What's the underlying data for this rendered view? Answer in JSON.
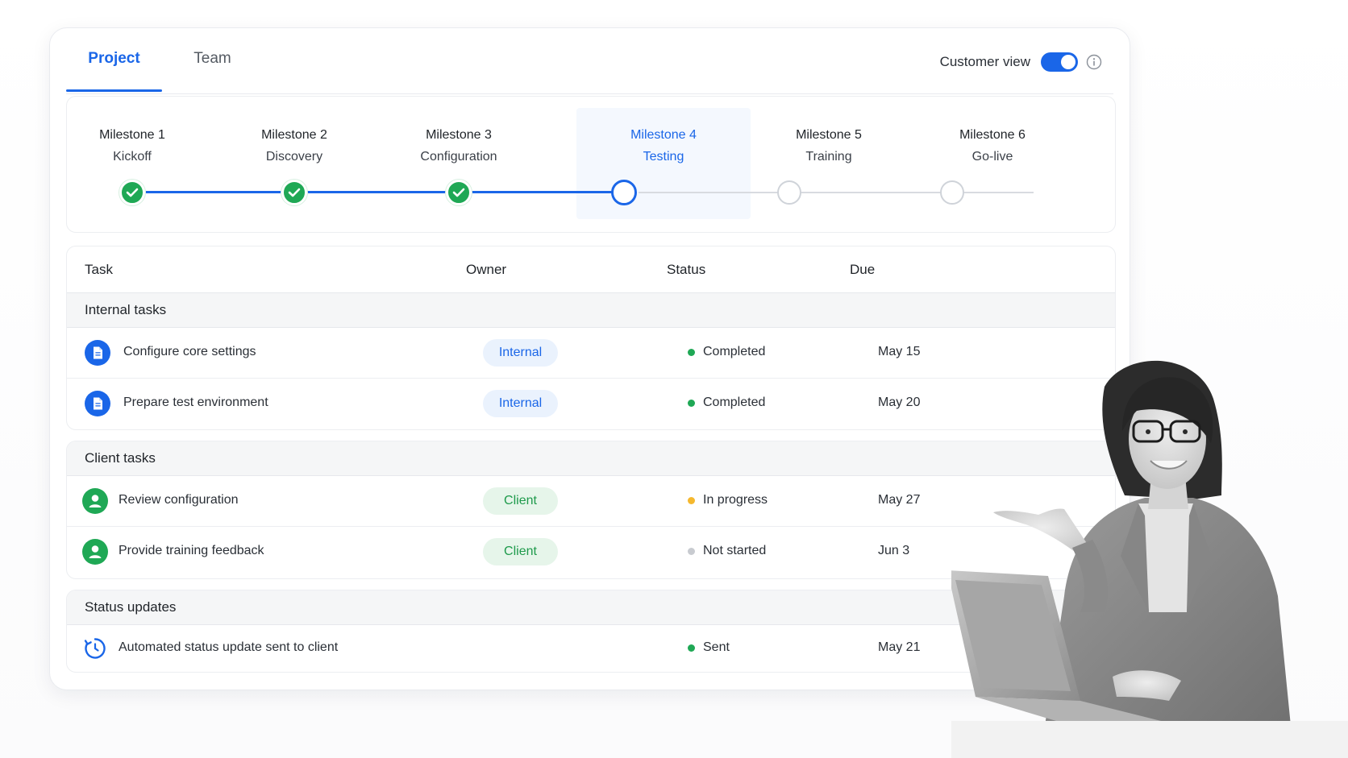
{
  "tabs": [
    {
      "label": "Project",
      "active": true
    },
    {
      "label": "Team",
      "active": false
    }
  ],
  "customer_view": {
    "label": "Customer view",
    "enabled": true
  },
  "milestones": [
    {
      "title": "Milestone 1",
      "subtitle": "Kickoff",
      "state": "done"
    },
    {
      "title": "Milestone 2",
      "subtitle": "Discovery",
      "state": "done"
    },
    {
      "title": "Milestone 3",
      "subtitle": "Configuration",
      "state": "done"
    },
    {
      "title": "Milestone 4",
      "subtitle": "Testing",
      "state": "current"
    },
    {
      "title": "Milestone 5",
      "subtitle": "Training",
      "state": "pending"
    },
    {
      "title": "Milestone 6",
      "subtitle": "Go-live",
      "state": "pending"
    }
  ],
  "table": {
    "headers": {
      "task": "Task",
      "owner": "Owner",
      "status": "Status",
      "due": "Due"
    },
    "groups": [
      {
        "label": "Internal tasks",
        "rows": [
          {
            "task": "Configure core settings",
            "owner": "Internal",
            "status": "Completed",
            "due": "May 15",
            "icon": "document-icon"
          },
          {
            "task": "Prepare test environment",
            "owner": "Internal",
            "status": "Completed",
            "due": "May 20",
            "icon": "document-icon"
          }
        ]
      },
      {
        "label": "Client tasks",
        "rows": [
          {
            "task": "Review configuration",
            "owner": "Client",
            "status": "In progress",
            "due": "May 27",
            "icon": "user-icon"
          },
          {
            "task": "Provide training feedback",
            "owner": "Client",
            "status": "Not started",
            "due": "Jun 3",
            "icon": "user-icon"
          }
        ]
      },
      {
        "label": "Status updates",
        "rows": [
          {
            "task": "Automated status update sent to client",
            "owner": "",
            "status": "Sent",
            "due": "May 21",
            "icon": "refresh-clock-icon"
          }
        ]
      }
    ]
  },
  "colors": {
    "accent": "#1a66e8",
    "success": "#1fa855",
    "warning": "#f5b82e",
    "neutral": "#c8cbd0"
  }
}
